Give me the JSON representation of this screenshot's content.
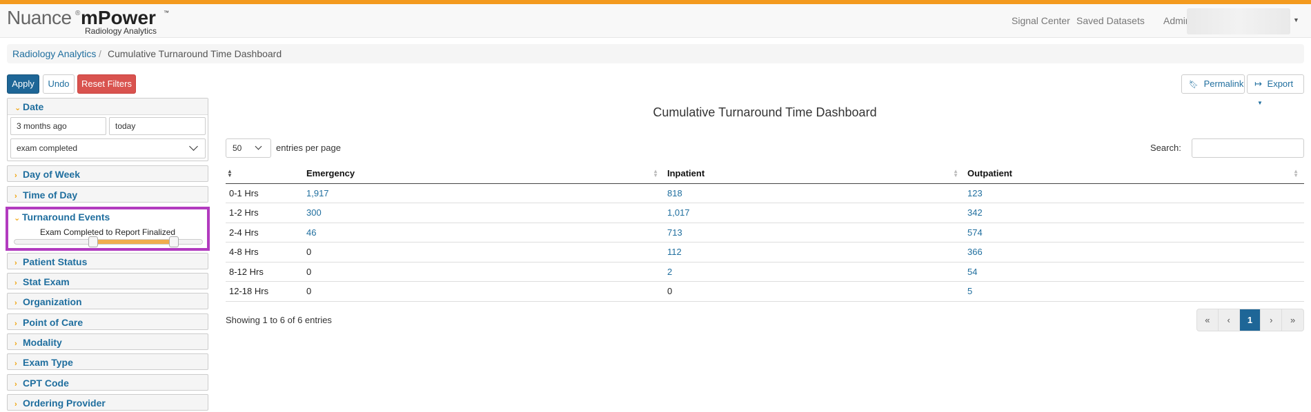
{
  "brand": {
    "name": "Nuance",
    "registered": "®",
    "product": "mPower",
    "trademark": "™",
    "subtitle": "Radiology Analytics"
  },
  "nav": {
    "items": [
      "Signal Center",
      "Saved Datasets",
      "Admin"
    ]
  },
  "breadcrumb": {
    "root": "Radiology Analytics",
    "separator": "/",
    "current": "Cumulative Turnaround Time Dashboard"
  },
  "toolbar": {
    "apply": "Apply",
    "undo": "Undo",
    "reset": "Reset Filters",
    "permalink": "Permalink",
    "export": "Export"
  },
  "filters": {
    "date": {
      "label": "Date",
      "from": "3 months ago",
      "to": "today",
      "event": "exam completed"
    },
    "collapsed_top": [
      "Day of Week",
      "Time of Day"
    ],
    "turnaround": {
      "label": "Turnaround Events",
      "slider_label": "Exam Completed to Report Finalized",
      "range_start": 0.42,
      "range_end": 0.85
    },
    "collapsed_bottom": [
      "Patient Status",
      "Stat Exam",
      "Organization",
      "Point of Care",
      "Modality",
      "Exam Type",
      "CPT Code",
      "Ordering Provider"
    ]
  },
  "dashboard": {
    "title": "Cumulative Turnaround Time Dashboard",
    "entries_value": "50",
    "entries_label": "entries per page",
    "search_label": "Search:",
    "columns": [
      "",
      "Emergency",
      "Inpatient",
      "Outpatient"
    ],
    "rows": [
      [
        "0-1 Hrs",
        "1,917",
        "818",
        "123"
      ],
      [
        "1-2 Hrs",
        "300",
        "1,017",
        "342"
      ],
      [
        "2-4 Hrs",
        "46",
        "713",
        "574"
      ],
      [
        "4-8 Hrs",
        "0",
        "112",
        "366"
      ],
      [
        "8-12 Hrs",
        "0",
        "2",
        "54"
      ],
      [
        "12-18 Hrs",
        "0",
        "0",
        "5"
      ]
    ],
    "info": "Showing 1 to 6 of 6 entries",
    "pagination": [
      "«",
      "‹",
      "1",
      "›",
      "»"
    ],
    "current_page": "1"
  },
  "colors": {
    "accent_bar": "#f39a1e",
    "link": "#1f6e9e",
    "primary": "#1e6697",
    "danger": "#d9534f",
    "highlight_border": "#b23bbf",
    "slider_range": "#f0ad4e"
  }
}
